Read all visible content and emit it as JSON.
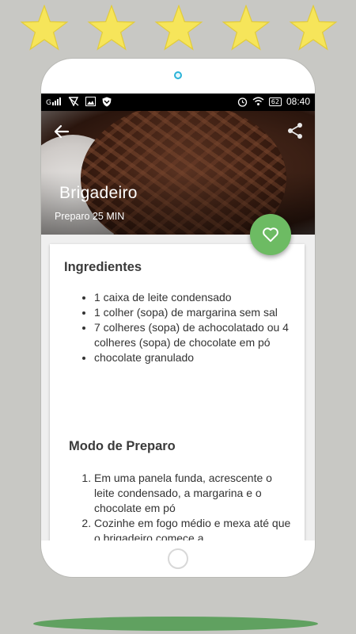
{
  "rating": {
    "stars": 5,
    "color": "#f6e55a"
  },
  "status_bar": {
    "carrier_label": "G",
    "time": "08:40",
    "battery": "62",
    "icons": [
      "signal-icon",
      "no-sim-icon",
      "image-icon",
      "shield-icon",
      "alarm-icon",
      "wifi-icon",
      "battery-icon"
    ]
  },
  "recipe": {
    "title": "Brigadeiro",
    "prep_time": "Preparo 25 MIN",
    "ingredients_title": "Ingredientes",
    "ingredients": [
      "1 caixa de leite condensado",
      "1 colher (sopa) de margarina sem sal",
      "7 colheres (sopa) de achocolatado ou 4 colheres (sopa) de chocolate em pó",
      "chocolate granulado"
    ],
    "method_title": "Modo de Preparo",
    "steps": [
      "Em uma panela funda, acrescente o leite condensado, a margarina e o chocolate em pó",
      "Cozinhe em fogo médio e mexa até que o brigadeiro comece a"
    ]
  },
  "colors": {
    "fab": "#6dbb63",
    "background": "#c8c8c4",
    "accent_shadow": "#4e9a4f"
  }
}
